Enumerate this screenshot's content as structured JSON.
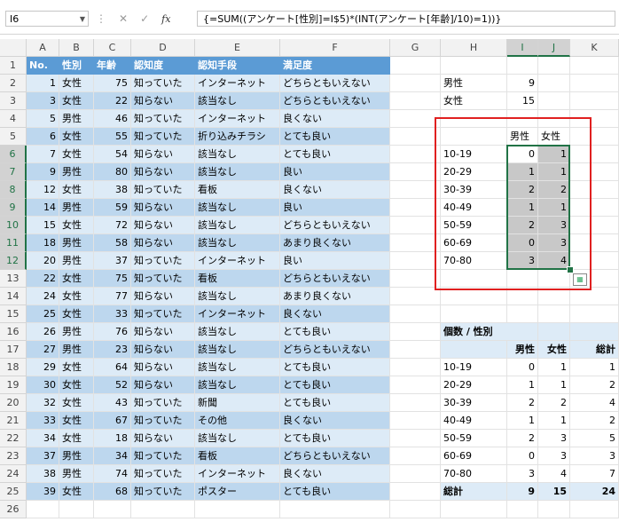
{
  "name_box": "I6",
  "formula": "{=SUM((アンケート[性別]=I$5)*(INT(アンケート[年齢]/10)=1))}",
  "columns": [
    "A",
    "B",
    "C",
    "D",
    "E",
    "F",
    "G",
    "H",
    "I",
    "J",
    "K"
  ],
  "rows": [
    "1",
    "2",
    "3",
    "4",
    "5",
    "6",
    "7",
    "8",
    "9",
    "10",
    "11",
    "12",
    "13",
    "14",
    "15",
    "16",
    "17",
    "18",
    "19",
    "20",
    "21",
    "22",
    "23",
    "24",
    "25",
    "26"
  ],
  "table": {
    "headers": [
      "No.",
      "性別",
      "年齢",
      "認知度",
      "認知手段",
      "満足度"
    ],
    "rows": [
      [
        "1",
        "女性",
        "75",
        "知っていた",
        "インターネット",
        "どちらともいえない"
      ],
      [
        "3",
        "女性",
        "22",
        "知らない",
        "該当なし",
        "どちらともいえない"
      ],
      [
        "5",
        "男性",
        "46",
        "知っていた",
        "インターネット",
        "良くない"
      ],
      [
        "6",
        "女性",
        "55",
        "知っていた",
        "折り込みチラシ",
        "とても良い"
      ],
      [
        "7",
        "女性",
        "54",
        "知らない",
        "該当なし",
        "とても良い"
      ],
      [
        "9",
        "男性",
        "80",
        "知らない",
        "該当なし",
        "良い"
      ],
      [
        "12",
        "女性",
        "38",
        "知っていた",
        "看板",
        "良くない"
      ],
      [
        "14",
        "男性",
        "59",
        "知らない",
        "該当なし",
        "良い"
      ],
      [
        "15",
        "女性",
        "72",
        "知らない",
        "該当なし",
        "どちらともいえない"
      ],
      [
        "18",
        "男性",
        "58",
        "知らない",
        "該当なし",
        "あまり良くない"
      ],
      [
        "20",
        "男性",
        "37",
        "知っていた",
        "インターネット",
        "良い"
      ],
      [
        "22",
        "女性",
        "75",
        "知っていた",
        "看板",
        "どちらともいえない"
      ],
      [
        "24",
        "女性",
        "77",
        "知らない",
        "該当なし",
        "あまり良くない"
      ],
      [
        "25",
        "女性",
        "33",
        "知っていた",
        "インターネット",
        "良くない"
      ],
      [
        "26",
        "男性",
        "76",
        "知らない",
        "該当なし",
        "とても良い"
      ],
      [
        "27",
        "男性",
        "23",
        "知らない",
        "該当なし",
        "どちらともいえない"
      ],
      [
        "29",
        "女性",
        "64",
        "知らない",
        "該当なし",
        "とても良い"
      ],
      [
        "30",
        "女性",
        "52",
        "知らない",
        "該当なし",
        "とても良い"
      ],
      [
        "32",
        "女性",
        "43",
        "知っていた",
        "新聞",
        "とても良い"
      ],
      [
        "33",
        "女性",
        "67",
        "知っていた",
        "その他",
        "良くない"
      ],
      [
        "34",
        "女性",
        "18",
        "知らない",
        "該当なし",
        "とても良い"
      ],
      [
        "37",
        "男性",
        "34",
        "知っていた",
        "看板",
        "どちらともいえない"
      ],
      [
        "38",
        "男性",
        "74",
        "知っていた",
        "インターネット",
        "良くない"
      ],
      [
        "39",
        "女性",
        "68",
        "知っていた",
        "ポスター",
        "とても良い"
      ]
    ]
  },
  "totals": [
    {
      "label": "男性",
      "value": "9"
    },
    {
      "label": "女性",
      "value": "15"
    }
  ],
  "crosstab": {
    "headers": [
      "男性",
      "女性"
    ],
    "rows": [
      {
        "label": "10-19",
        "m": "0",
        "f": "1"
      },
      {
        "label": "20-29",
        "m": "1",
        "f": "1"
      },
      {
        "label": "30-39",
        "m": "2",
        "f": "2"
      },
      {
        "label": "40-49",
        "m": "1",
        "f": "1"
      },
      {
        "label": "50-59",
        "m": "2",
        "f": "3"
      },
      {
        "label": "60-69",
        "m": "0",
        "f": "3"
      },
      {
        "label": "70-80",
        "m": "3",
        "f": "4"
      }
    ]
  },
  "pivot": {
    "title": "個数 / 性別",
    "headers": [
      "男性",
      "女性",
      "総計"
    ],
    "rows": [
      {
        "label": "10-19",
        "m": "0",
        "f": "1",
        "t": "1"
      },
      {
        "label": "20-29",
        "m": "1",
        "f": "1",
        "t": "2"
      },
      {
        "label": "30-39",
        "m": "2",
        "f": "2",
        "t": "4"
      },
      {
        "label": "40-49",
        "m": "1",
        "f": "1",
        "t": "2"
      },
      {
        "label": "50-59",
        "m": "2",
        "f": "3",
        "t": "5"
      },
      {
        "label": "60-69",
        "m": "0",
        "f": "3",
        "t": "3"
      },
      {
        "label": "70-80",
        "m": "3",
        "f": "4",
        "t": "7"
      }
    ],
    "total": {
      "label": "総計",
      "m": "9",
      "f": "15",
      "t": "24"
    }
  },
  "colors": {
    "table_header": "#5b9bd5",
    "band_light": "#ddebf7",
    "band_dark": "#bdd7ee",
    "selection": "#217346",
    "highlight_box": "#e02020"
  },
  "icons": [
    "dropdown-arrow-icon",
    "more-options-icon",
    "cancel-icon",
    "enter-icon",
    "function-icon",
    "quick-analysis-icon"
  ]
}
